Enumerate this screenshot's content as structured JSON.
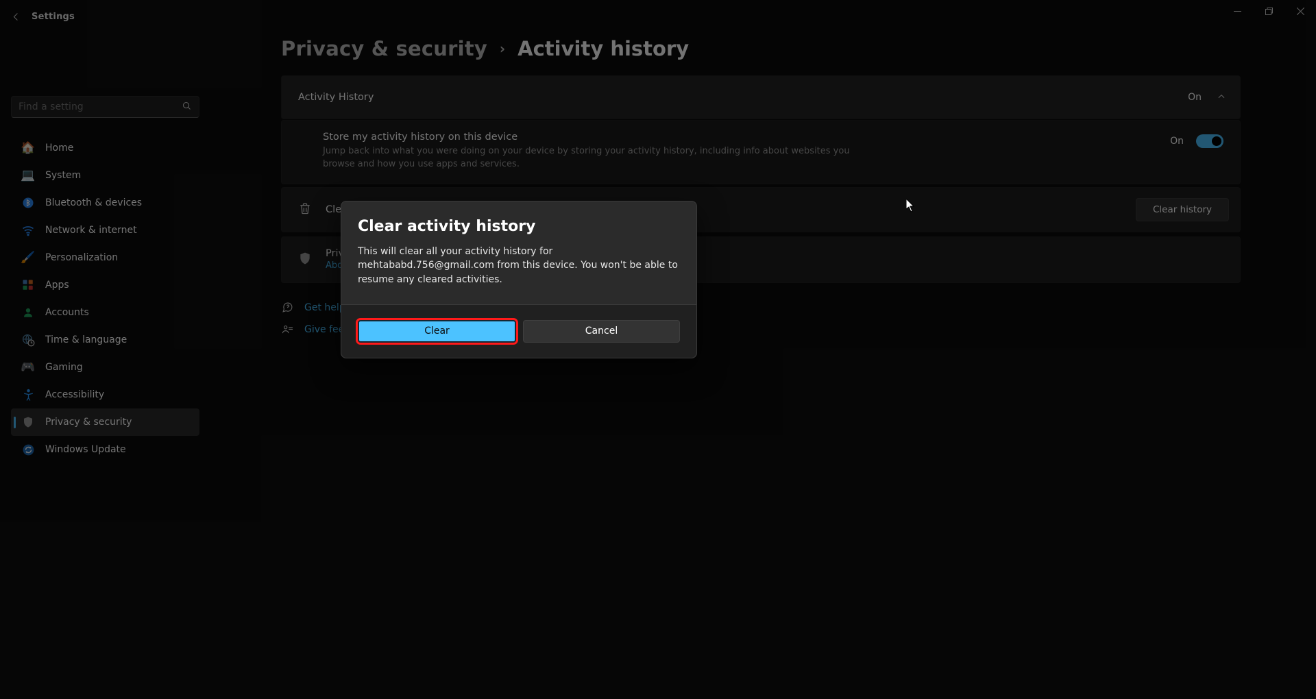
{
  "app_title": "Settings",
  "search": {
    "placeholder": "Find a setting"
  },
  "sidebar": {
    "items": [
      {
        "label": "Home",
        "icon": "home-icon"
      },
      {
        "label": "System",
        "icon": "system-icon"
      },
      {
        "label": "Bluetooth & devices",
        "icon": "bluetooth-icon"
      },
      {
        "label": "Network & internet",
        "icon": "wifi-icon"
      },
      {
        "label": "Personalization",
        "icon": "brush-icon"
      },
      {
        "label": "Apps",
        "icon": "apps-icon"
      },
      {
        "label": "Accounts",
        "icon": "person-icon"
      },
      {
        "label": "Time & language",
        "icon": "globe-clock-icon"
      },
      {
        "label": "Gaming",
        "icon": "gamepad-icon"
      },
      {
        "label": "Accessibility",
        "icon": "accessibility-icon"
      },
      {
        "label": "Privacy & security",
        "icon": "shield-icon",
        "active": true
      },
      {
        "label": "Windows Update",
        "icon": "update-icon"
      }
    ]
  },
  "breadcrumb": {
    "a": "Privacy & security",
    "b": "Activity history"
  },
  "panel": {
    "header": {
      "title": "Activity History",
      "state": "On"
    },
    "store": {
      "title": "Store my activity history on this device",
      "desc": "Jump back into what you were doing on your device by storing your activity history, including info about websites you browse and how you use apps and services.",
      "state": "On"
    },
    "clear_row": {
      "title": "Clear activity history for this account",
      "button": "Clear history"
    },
    "dashboard": {
      "title": "Privacy dashboard",
      "link": "About Windows privacy options"
    }
  },
  "links": {
    "help": "Get help",
    "feedback": "Give feedback"
  },
  "dialog": {
    "title": "Clear activity history",
    "body": "This will clear all your activity history for mehtababd.756@gmail.com from this device. You won't be able to resume any cleared activities.",
    "primary": "Clear",
    "secondary": "Cancel"
  }
}
